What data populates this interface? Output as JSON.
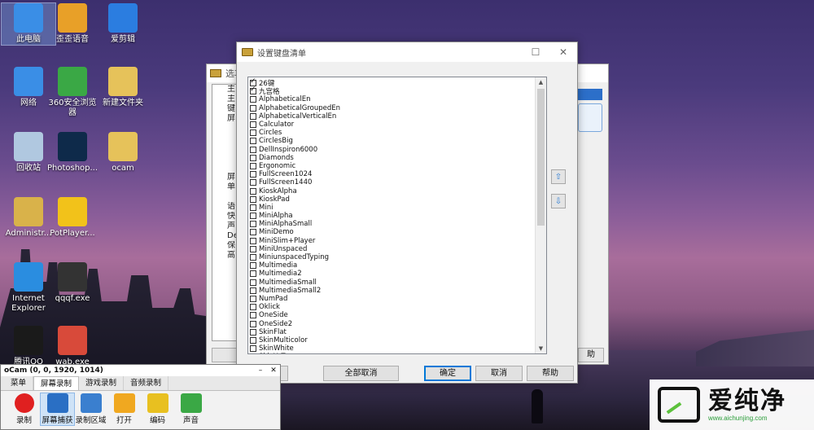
{
  "desktop": {
    "icons": [
      {
        "label": "此电脑",
        "icon": "computer-icon",
        "color": "#3a8ee6"
      },
      {
        "label": "歪歪语音",
        "icon": "raccoon-app-icon",
        "color": "#e8a028"
      },
      {
        "label": "爱剪辑",
        "icon": "video-edit-icon",
        "color": "#2b7de0"
      },
      {
        "label": "网络",
        "icon": "network-icon",
        "color": "#3a8ee6"
      },
      {
        "label": "360安全浏览器",
        "icon": "browser-360-icon",
        "color": "#3aa845"
      },
      {
        "label": "新建文件夹",
        "icon": "folder-icon",
        "color": "#e6c25a"
      },
      {
        "label": "回收站",
        "icon": "recycle-bin-icon",
        "color": "#b0c8e0"
      },
      {
        "label": "Photoshop...",
        "icon": "photoshop-icon",
        "color": "#0e2a4a"
      },
      {
        "label": "ocam",
        "icon": "folder-icon",
        "color": "#e6c25a"
      },
      {
        "label": "Administr...",
        "icon": "user-folder-icon",
        "color": "#d9b24a"
      },
      {
        "label": "PotPlayer...",
        "icon": "potplayer-icon",
        "color": "#f2c21a"
      },
      {
        "label": "Internet Explorer",
        "icon": "ie-icon",
        "color": "#2a8de0"
      },
      {
        "label": "qqqf.exe",
        "icon": "exe-icon",
        "color": "#333333"
      },
      {
        "label": "腾讯QQ",
        "icon": "qq-icon",
        "color": "#1a1a1a"
      },
      {
        "label": "wab.exe",
        "icon": "wab-icon",
        "color": "#d84a3a"
      }
    ]
  },
  "options_window": {
    "title": "选项",
    "tree_items": [
      "主",
      "主",
      "键",
      "屏",
      "",
      "",
      "",
      "",
      "",
      "屏",
      "单",
      "",
      "语",
      "快",
      "声",
      "De",
      "保",
      "高"
    ],
    "buttons": [
      "",
      "助"
    ]
  },
  "dialog": {
    "title": "设置键盘清单",
    "minimize": "☐",
    "close": "✕",
    "items": [
      {
        "label": "26键",
        "checked": true
      },
      {
        "label": "九宫格",
        "checked": true
      },
      {
        "label": "AlphabeticalEn",
        "checked": false
      },
      {
        "label": "AlphabeticalGroupedEn",
        "checked": false
      },
      {
        "label": "AlphabeticalVerticalEn",
        "checked": false
      },
      {
        "label": "Calculator",
        "checked": false
      },
      {
        "label": "Circles",
        "checked": false
      },
      {
        "label": "CirclesBig",
        "checked": false
      },
      {
        "label": "DellInspiron6000",
        "checked": false
      },
      {
        "label": "Diamonds",
        "checked": false
      },
      {
        "label": "Ergonomic",
        "checked": false
      },
      {
        "label": "FullScreen1024",
        "checked": false
      },
      {
        "label": "FullScreen1440",
        "checked": false
      },
      {
        "label": "KioskAlpha",
        "checked": false
      },
      {
        "label": "KioskPad",
        "checked": false
      },
      {
        "label": "Mini",
        "checked": false
      },
      {
        "label": "MiniAlpha",
        "checked": false
      },
      {
        "label": "MiniAlphaSmall",
        "checked": false
      },
      {
        "label": "MiniDemo",
        "checked": false
      },
      {
        "label": "MiniSlim+Player",
        "checked": false
      },
      {
        "label": "MiniUnspaced",
        "checked": false
      },
      {
        "label": "MiniunspacedTyping",
        "checked": false
      },
      {
        "label": "Multimedia",
        "checked": false
      },
      {
        "label": "Multimedia2",
        "checked": false
      },
      {
        "label": "MultimediaSmall",
        "checked": false
      },
      {
        "label": "MultimediaSmall2",
        "checked": false
      },
      {
        "label": "NumPad",
        "checked": false
      },
      {
        "label": "Oklick",
        "checked": false
      },
      {
        "label": "OneSide",
        "checked": false
      },
      {
        "label": "OneSide2",
        "checked": false
      },
      {
        "label": "SkinFlat",
        "checked": false
      },
      {
        "label": "SkinMulticolor",
        "checked": false
      },
      {
        "label": "SkinWhite",
        "checked": false
      },
      {
        "label": "SkinYoTo",
        "checked": false
      }
    ],
    "buttons": {
      "select_all": "选",
      "deselect_all": "全部取消",
      "ok": "确定",
      "cancel": "取消",
      "help": "帮助"
    }
  },
  "ocam": {
    "title": "oCam (0, 0, 1920, 1014)",
    "tabs": [
      {
        "label": "菜单",
        "active": false
      },
      {
        "label": "屏幕录制",
        "active": true
      },
      {
        "label": "游戏录制",
        "active": false
      },
      {
        "label": "音频录制",
        "active": false
      }
    ],
    "tools": [
      {
        "label": "录制",
        "icon": "record-icon",
        "color": "#e02020"
      },
      {
        "label": "屏幕捕获",
        "icon": "monitor-icon",
        "color": "#2a6fc4"
      },
      {
        "label": "录制区域",
        "icon": "region-icon",
        "color": "#3a7fcf"
      },
      {
        "label": "打开",
        "icon": "open-folder-icon",
        "color": "#f0a820"
      },
      {
        "label": "编码",
        "icon": "codec-icon",
        "color": "#e8c020"
      },
      {
        "label": "声音",
        "icon": "microphone-icon",
        "color": "#3aa845"
      }
    ]
  },
  "watermark": {
    "text": "爱纯净",
    "url": "www.aichunjing.com"
  }
}
